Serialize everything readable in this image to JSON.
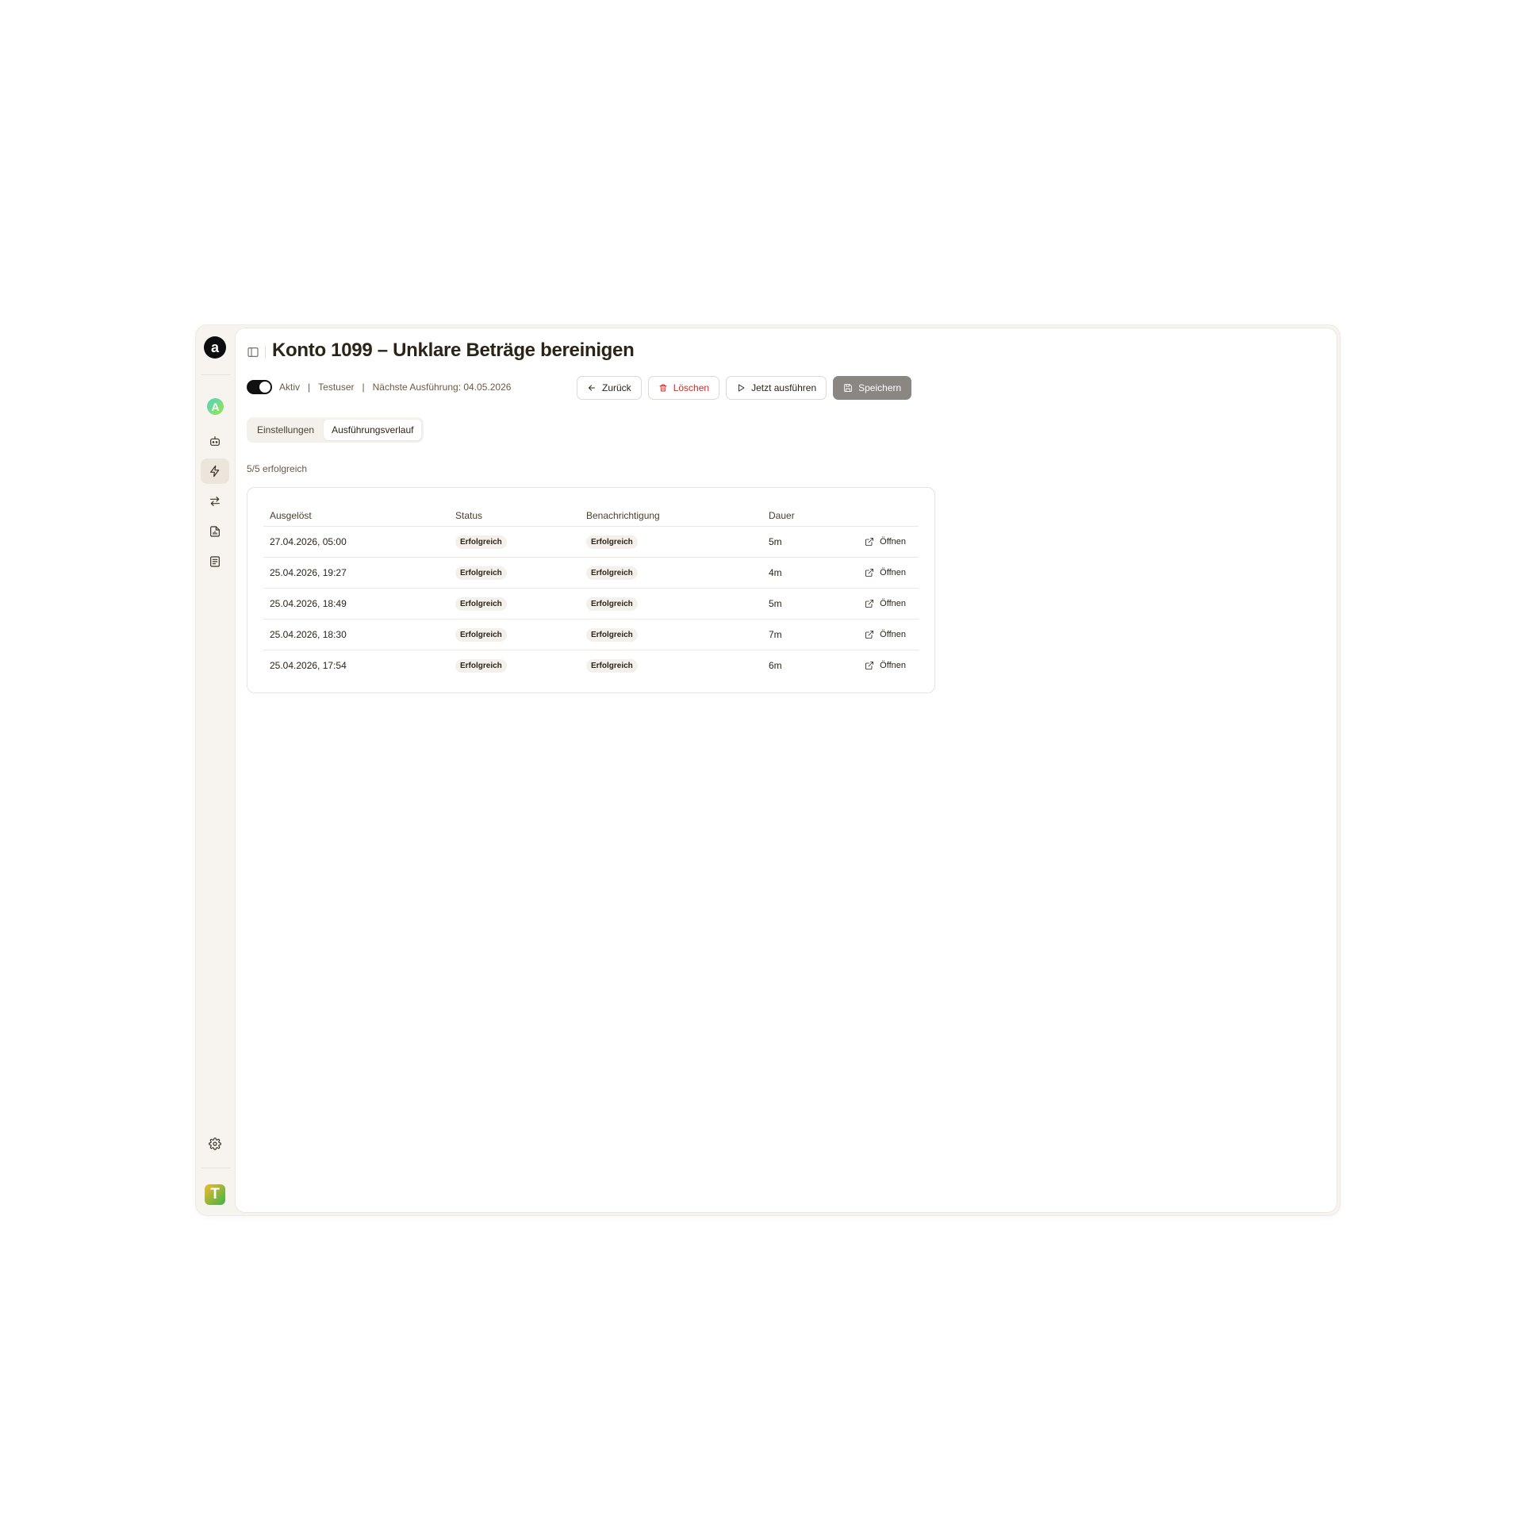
{
  "sidebar": {
    "logo_letter": "a",
    "workspace_letter": "A",
    "avatar_letter": "T",
    "items": [
      {
        "icon": "bot-icon",
        "name": "sidebar-item-agents"
      },
      {
        "icon": "zap-icon",
        "name": "sidebar-item-automations",
        "active": true
      },
      {
        "icon": "arrows-exchange-icon",
        "name": "sidebar-item-transactions"
      },
      {
        "icon": "report-file-icon",
        "name": "sidebar-item-reports"
      },
      {
        "icon": "document-list-icon",
        "name": "sidebar-item-documents"
      }
    ],
    "settings_icon": "gear-icon"
  },
  "header": {
    "title": "Konto 1099 – Unklare Beträge bereinigen"
  },
  "meta": {
    "status_label": "Aktiv",
    "user": "Testuser",
    "next_run": "Nächste Ausführung: 04.05.2026",
    "separator": "|"
  },
  "actions": {
    "back_label": "Zurück",
    "delete_label": "Löschen",
    "run_label": "Jetzt ausführen",
    "save_label": "Speichern"
  },
  "tabs": [
    {
      "label": "Einstellungen",
      "active": false
    },
    {
      "label": "Ausführungsverlauf",
      "active": true
    }
  ],
  "summary": "5/5 erfolgreich",
  "table": {
    "headers": [
      "Ausgelöst",
      "Status",
      "Benachrichtigung",
      "Dauer",
      ""
    ],
    "rows": [
      {
        "triggered": "27.04.2026, 05:00",
        "status": "Erfolgreich",
        "notification": "Erfolgreich",
        "duration": "5m",
        "action": "Öffnen"
      },
      {
        "triggered": "25.04.2026, 19:27",
        "status": "Erfolgreich",
        "notification": "Erfolgreich",
        "duration": "4m",
        "action": "Öffnen"
      },
      {
        "triggered": "25.04.2026, 18:49",
        "status": "Erfolgreich",
        "notification": "Erfolgreich",
        "duration": "5m",
        "action": "Öffnen"
      },
      {
        "triggered": "25.04.2026, 18:30",
        "status": "Erfolgreich",
        "notification": "Erfolgreich",
        "duration": "7m",
        "action": "Öffnen"
      },
      {
        "triggered": "25.04.2026, 17:54",
        "status": "Erfolgreich",
        "notification": "Erfolgreich",
        "duration": "6m",
        "action": "Öffnen"
      }
    ]
  },
  "colors": {
    "delete": "#dc2626",
    "save_bg": "#8a8783",
    "sidebar_bg": "#f7f4f0"
  }
}
